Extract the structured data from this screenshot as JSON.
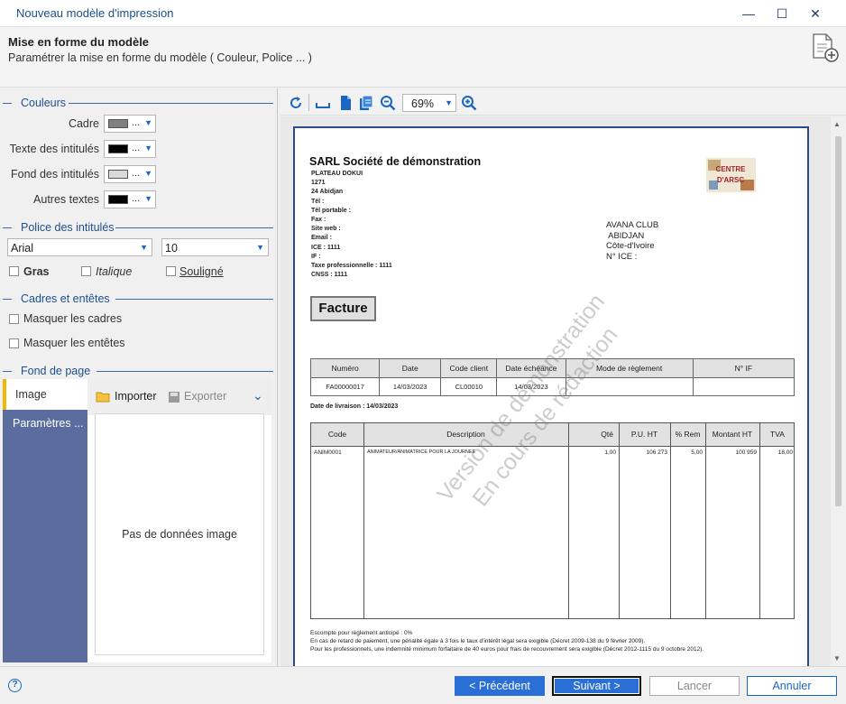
{
  "window": {
    "title": "Nouveau modèle d'impression",
    "minimize": "—",
    "maximize": "☐",
    "close": "✕"
  },
  "header": {
    "title": "Mise en forme du modèle",
    "subtitle": "Paramétrer la mise en forme du modèle ( Couleur, Police ... )"
  },
  "colors": {
    "section_label": "Couleurs",
    "fields": [
      {
        "label": "Cadre",
        "swatch": "#808080"
      },
      {
        "label": "Texte des intitulés",
        "swatch": "#000000"
      },
      {
        "label": "Fond des intitulés",
        "swatch": "#d9d9d9"
      },
      {
        "label": "Autres textes",
        "swatch": "#000000"
      }
    ],
    "dots": "..."
  },
  "font": {
    "section_label": "Police des intitulés",
    "family": "Arial",
    "size": "10",
    "bold": "Gras",
    "italic": "Italique",
    "underline": "Souligné"
  },
  "frames": {
    "section_label": "Cadres et entêtes",
    "hide_frames": "Masquer les cadres",
    "hide_headers": "Masquer les entêtes"
  },
  "background": {
    "section_label": "Fond de page",
    "tab_image": "Image",
    "tab_params": "Paramètres ...",
    "import": "Importer",
    "export": "Exporter",
    "empty": "Pas de données image"
  },
  "preview": {
    "zoom": "69%",
    "document": {
      "company": "SARL Société de démonstration",
      "company_lines": [
        "PLATEAU DOKUI",
        "1271",
        "24 Abidjan",
        "Tél :",
        "Tél portable :",
        "Fax :",
        "Site web :",
        "Email :",
        "ICE : 1111",
        "IF :",
        "Taxe professionnelle : 1111",
        "CNSS : 1111"
      ],
      "client_lines": [
        "AVANA CLUB",
        " ABIDJAN",
        "Côte-d'Ivoire",
        "N° ICE :"
      ],
      "logo_text": "CENTRE D'ARSC",
      "doc_type": "Facture",
      "info_headers": [
        "Numéro",
        "Date",
        "Code client",
        "Date échéance",
        "Mode de règlement",
        "N° IF"
      ],
      "info_values": [
        "FA00000017",
        "14/03/2023",
        "CL00010",
        "14/03/2023",
        "",
        ""
      ],
      "delivery": "Date de livraison :  14/03/2023",
      "item_headers": [
        "Code",
        "Description",
        "Qté",
        "P.U. HT",
        "% Rem",
        "Montant HT",
        "TVA"
      ],
      "item_row": [
        "ANIM0001",
        "ANIMATEUR/ANIMATRICE POUR LA JOURNEE",
        "1,00",
        "106 273",
        "5,00",
        "100 959",
        "18,00"
      ],
      "notes": [
        "Escompte pour règlement anticipé : 0%",
        "En cas de retard de paiement, une pénalité égale à 3 fois le taux d'intérêt légal sera exigible (Décret 2009-138 du 9 février 2009).",
        "Pour les professionnels, une indemnité minimum forfaitaire de 40 euros pour frais de recouvrement sera exigible (Décret 2012-1115 du 9 octobre 2012)."
      ],
      "watermark": [
        "Version de démonstration",
        "En cours de rédaction"
      ]
    }
  },
  "footer": {
    "help": "?",
    "prev": "< Précédent",
    "next": "Suivant >",
    "launch": "Lancer",
    "cancel": "Annuler"
  }
}
